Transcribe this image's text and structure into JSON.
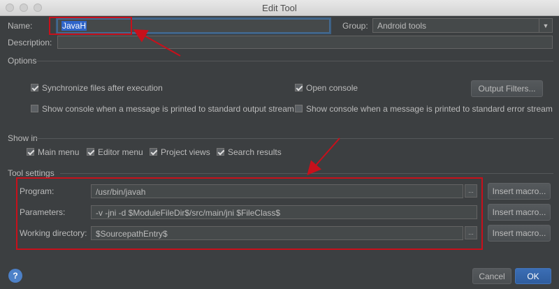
{
  "window": {
    "title": "Edit Tool"
  },
  "name": {
    "label": "Name:",
    "value": "JavaH"
  },
  "group": {
    "label": "Group:",
    "value": "Android tools"
  },
  "description": {
    "label": "Description:",
    "value": ""
  },
  "options": {
    "heading": "Options",
    "sync_files": {
      "label": "Synchronize files after execution",
      "checked": true
    },
    "open_console": {
      "label": "Open console",
      "checked": true
    },
    "output_filters_button": "Output Filters...",
    "console_stdout": {
      "label": "Show console when a message is printed to standard output stream",
      "checked": false
    },
    "console_stderr": {
      "label": "Show console when a message is printed to standard error stream",
      "checked": false
    }
  },
  "show_in": {
    "heading": "Show in",
    "items": [
      {
        "label": "Main menu",
        "checked": true
      },
      {
        "label": "Editor menu",
        "checked": true
      },
      {
        "label": "Project views",
        "checked": true
      },
      {
        "label": "Search results",
        "checked": true
      }
    ]
  },
  "tool_settings": {
    "heading": "Tool settings",
    "program": {
      "label": "Program:",
      "value": "/usr/bin/javah"
    },
    "parameters": {
      "label": "Parameters:",
      "value": "-v -jni -d $ModuleFileDir$/src/main/jni $FileClass$"
    },
    "working_directory": {
      "label": "Working directory:",
      "value": "$SourcepathEntry$"
    },
    "browse_label": "...",
    "insert_macro_label": "Insert macro..."
  },
  "footer": {
    "help_label": "?",
    "cancel_label": "Cancel",
    "ok_label": "OK"
  },
  "annotation_color": "#c8101b"
}
